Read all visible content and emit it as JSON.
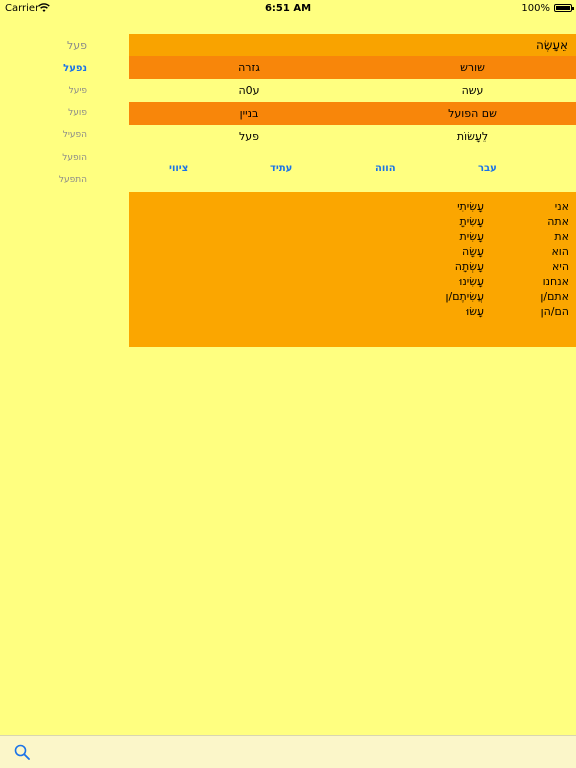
{
  "status_bar": {
    "carrier": "Carrier",
    "time": "6:51 AM",
    "battery": "100%"
  },
  "sidebar": {
    "items": [
      {
        "label": "פעל"
      },
      {
        "label": "נפעל"
      },
      {
        "label": "פיעל"
      },
      {
        "label": "פועל"
      },
      {
        "label": "הפעיל"
      },
      {
        "label": "הופעל"
      },
      {
        "label": "התפעל"
      }
    ],
    "active_index": 1
  },
  "word": "אֵעָשֶׂה",
  "info": {
    "root_label": "שורש",
    "root_value": "עשה",
    "pattern_label": "גזרה",
    "pattern_value": "ע0ה",
    "infinitive_label": "שם הפועל",
    "infinitive_value": "לֵעָשׂוֹת",
    "binyan_label": "בניין",
    "binyan_value": "פעל"
  },
  "tenses": {
    "past": "עבר",
    "present": "הווה",
    "future": "עתיד",
    "imperative": "ציווי"
  },
  "conjugation": [
    {
      "pronoun": "אני",
      "form": "עָשִׂיתִי"
    },
    {
      "pronoun": "אתה",
      "form": "עָשִׂיתָ"
    },
    {
      "pronoun": "את",
      "form": "עָשִׂית"
    },
    {
      "pronoun": "הוא",
      "form": "עָשָׂה"
    },
    {
      "pronoun": "היא",
      "form": "עָשְׂתָה"
    },
    {
      "pronoun": "אנחנו",
      "form": "עָשִׂינוּ"
    },
    {
      "pronoun": "אתם/ן",
      "form": "עֲשִׂיתֶם/ן"
    },
    {
      "pronoun": "הם/הן",
      "form": "עָשׂוּ"
    }
  ],
  "colors": {
    "background": "#ffff80",
    "header_orange": "#f9a300",
    "row_orange": "#f8860a",
    "accent_blue": "#1a73e8"
  },
  "toolbar": {
    "search_icon": "search-icon"
  }
}
